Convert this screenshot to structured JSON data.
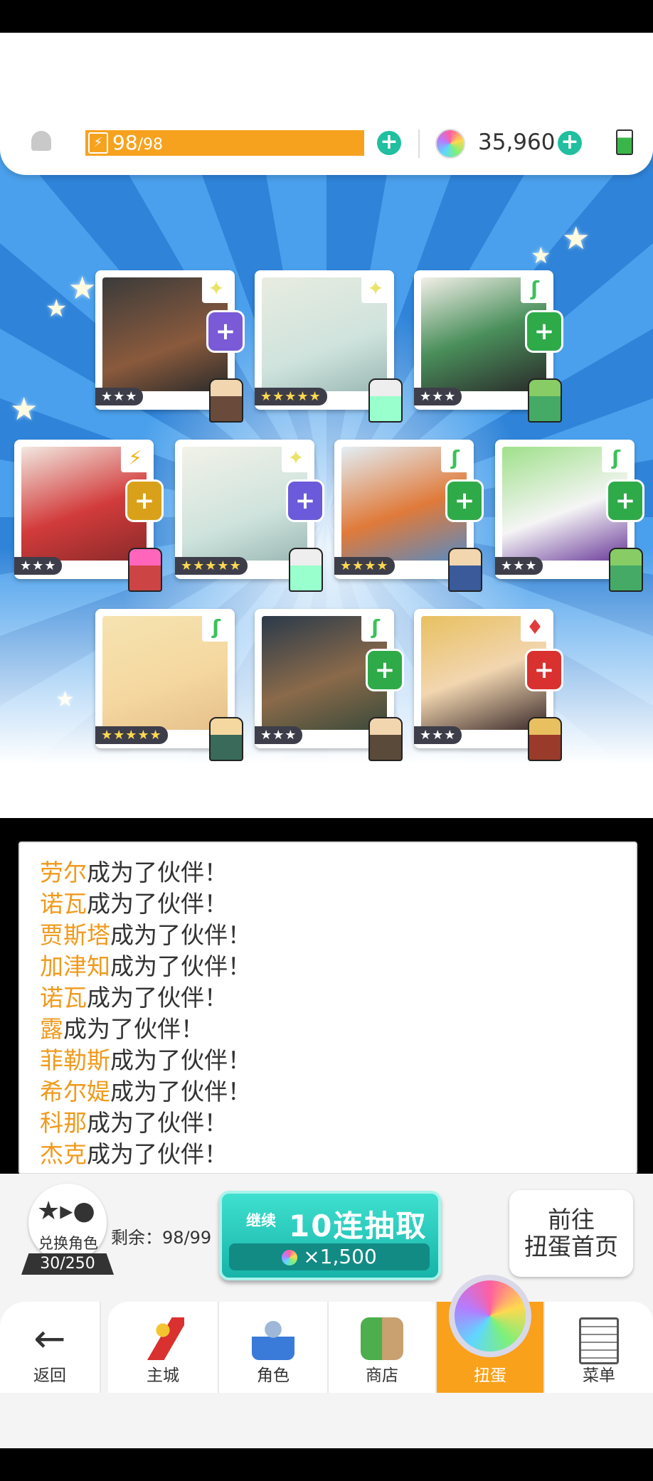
{
  "header": {
    "stamina_current": "98",
    "stamina_max": "/98",
    "gems": "35,960"
  },
  "roster": [
    {
      "stars": "★★★",
      "element": "✦",
      "element_color": "#e9e36a",
      "badge_color": "#7a5ad6"
    },
    {
      "stars": "★★★★★",
      "element": "✦",
      "element_color": "#e9e36a",
      "badge_color": ""
    },
    {
      "stars": "★★★",
      "element": "ʃ",
      "element_color": "#3cc15b",
      "badge_color": "#2eaa48"
    },
    {
      "stars": "★★★",
      "element": "⚡",
      "element_color": "#f2b21b",
      "badge_color": "#d9a11a"
    },
    {
      "stars": "★★★★★",
      "element": "✦",
      "element_color": "#e9e36a",
      "badge_color": "#6b5ad9"
    },
    {
      "stars": "★★★★",
      "element": "ʃ",
      "element_color": "#3cc15b",
      "badge_color": "#2eaa48"
    },
    {
      "stars": "★★★",
      "element": "ʃ",
      "element_color": "#3cc15b",
      "badge_color": "#2eaa48"
    },
    {
      "stars": "★★★★★",
      "element": "ʃ",
      "element_color": "#3cc15b",
      "badge_color": ""
    },
    {
      "stars": "★★★",
      "element": "ʃ",
      "element_color": "#3cc15b",
      "badge_color": "#2eaa48"
    },
    {
      "stars": "★★★",
      "element": "♦",
      "element_color": "#e23b3b",
      "badge_color": "#d8312f"
    }
  ],
  "log": {
    "suffix": "成为了伙伴！",
    "names": [
      "劳尔",
      "诺瓦",
      "贾斯塔",
      "加津知",
      "诺瓦",
      "露",
      "菲勒斯",
      "希尔媞",
      "科那",
      "杰克"
    ]
  },
  "exchange": {
    "label": "兑换角色",
    "count": "30/250"
  },
  "remaining": "剩余：98/99",
  "draw_button": {
    "continue_label": "继续",
    "main_label": "10连抽取",
    "cost": "×1,500"
  },
  "home_button": {
    "line1": "前往",
    "line2": "扭蛋首页"
  },
  "nav": {
    "back": "返回",
    "city": "主城",
    "characters": "角色",
    "shop": "商店",
    "gacha": "扭蛋",
    "menu": "菜单"
  },
  "colors": {
    "accent_orange": "#f9a11b",
    "teal": "#1fbf9f",
    "log_name": "#f09a1c"
  }
}
